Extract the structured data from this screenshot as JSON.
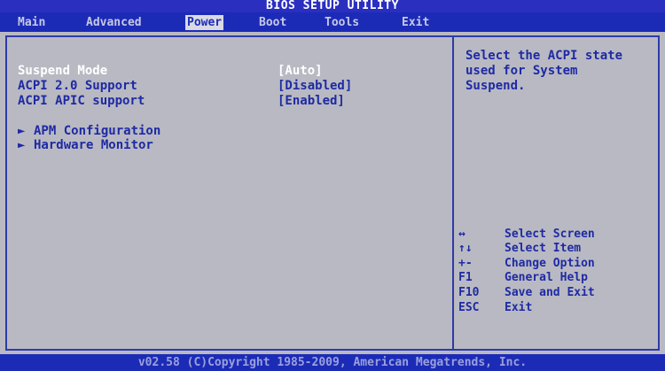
{
  "title": "BIOS SETUP UTILITY",
  "menu": [
    {
      "label": "Main"
    },
    {
      "label": "Advanced"
    },
    {
      "label": "Power",
      "active": true
    },
    {
      "label": "Boot"
    },
    {
      "label": "Tools"
    },
    {
      "label": "Exit"
    }
  ],
  "settings": [
    {
      "label": "Suspend Mode",
      "value": "[Auto]"
    },
    {
      "label": "ACPI 2.0 Support",
      "value": "[Disabled]"
    },
    {
      "label": "ACPI APIC support",
      "value": "[Enabled]"
    }
  ],
  "submenus": [
    {
      "label": "APM Configuration"
    },
    {
      "label": "Hardware Monitor"
    }
  ],
  "help": {
    "text": "Select the ACPI state\nused for System\nSuspend."
  },
  "keys": [
    {
      "key": "↔",
      "desc": "Select Screen"
    },
    {
      "key": "↑↓",
      "desc": "Select Item"
    },
    {
      "key": "+-",
      "desc": "Change Option"
    },
    {
      "key": "F1",
      "desc": "General Help"
    },
    {
      "key": "F10",
      "desc": "Save and Exit"
    },
    {
      "key": "ESC",
      "desc": "Exit"
    }
  ],
  "footer": "v02.58 (C)Copyright 1985-2009, American Megatrends, Inc.",
  "colors": {
    "menu_bar": "#1c2bb6",
    "background": "#b9b9c3",
    "text": "#1e2aa3",
    "selected_text": "#ffffff"
  }
}
